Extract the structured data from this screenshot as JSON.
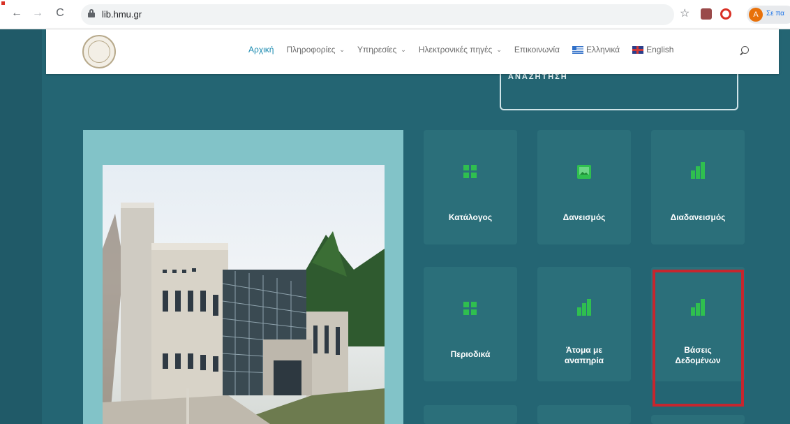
{
  "browser": {
    "url": "lib.hmu.gr",
    "profile_initial": "A",
    "profile_label": "Σε πα"
  },
  "nav": {
    "items": [
      {
        "label": "Αρχική",
        "active": true,
        "dropdown": false
      },
      {
        "label": "Πληροφορίες",
        "active": false,
        "dropdown": true
      },
      {
        "label": "Υπηρεσίες",
        "active": false,
        "dropdown": true
      },
      {
        "label": "Ηλεκτρονικές πηγές",
        "active": false,
        "dropdown": true
      },
      {
        "label": "Επικοινωνία",
        "active": false,
        "dropdown": false
      }
    ],
    "lang_greek": "Ελληνικά",
    "lang_english": "English"
  },
  "search": {
    "label": "ΑΝΑΖΗΤΗΣΗ"
  },
  "tiles": [
    {
      "label": "Κατάλογος",
      "icon": "grid-icon"
    },
    {
      "label": "Δανεισμός",
      "icon": "image-icon"
    },
    {
      "label": "Διαδανεισμός",
      "icon": "bar-chart-icon"
    },
    {
      "label": "Περιοδικά",
      "icon": "grid-icon"
    },
    {
      "label": "Άτομα με αναπηρία",
      "icon": "bar-chart-icon"
    },
    {
      "label": "Βάσεις Δεδομένων",
      "icon": "bar-chart-icon",
      "highlighted": true
    }
  ],
  "colors": {
    "page_bg": "#246573",
    "tile_bg": "#2b6f7a",
    "icon_green": "#2fbf4f",
    "highlight_red": "#c6262e",
    "nav_active": "#1a8ab0"
  }
}
